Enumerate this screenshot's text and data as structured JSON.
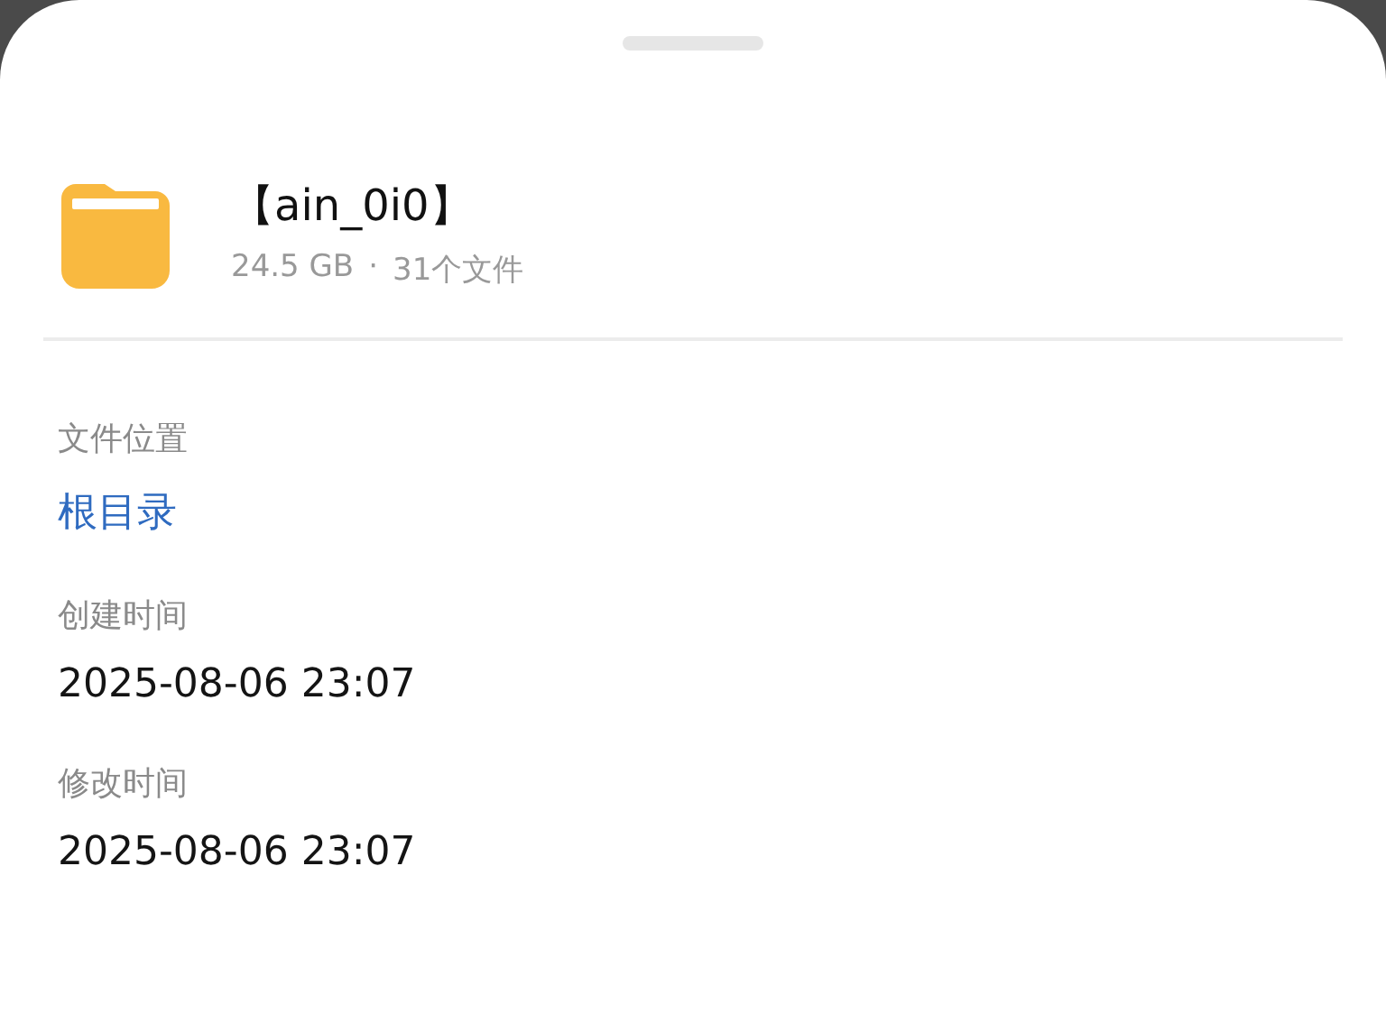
{
  "file": {
    "name": "【ain_0i0】",
    "size": "24.5 GB",
    "separator": "·",
    "count": "31个文件"
  },
  "details": [
    {
      "label": "文件位置",
      "value": "根目录",
      "kind": "link"
    },
    {
      "label": "创建时间",
      "value": "2025-08-06 23:07",
      "kind": "text"
    },
    {
      "label": "修改时间",
      "value": "2025-08-06 23:07",
      "kind": "text"
    }
  ]
}
